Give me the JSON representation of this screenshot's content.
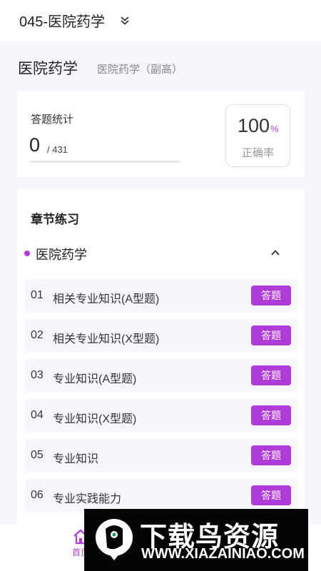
{
  "header": {
    "title": "045-医院药学",
    "dropdown_icon": "double-chevron-down-icon"
  },
  "subject": {
    "name": "医院药学",
    "level": "医院药学（副高）"
  },
  "stats": {
    "label": "答题统计",
    "answered": "0",
    "total": "/ 431",
    "progress": 0,
    "accuracy_value": "100",
    "accuracy_unit": "%",
    "accuracy_label": "正确率"
  },
  "chapters": {
    "title": "章节练习",
    "group": {
      "name": "医院药学",
      "expand_icon": "chevron-up-icon"
    },
    "items": [
      {
        "num": "01",
        "title": "相关专业知识(A型题)",
        "action": "答题"
      },
      {
        "num": "02",
        "title": "相关专业知识(X型题)",
        "action": "答题"
      },
      {
        "num": "03",
        "title": "专业知识(A型题)",
        "action": "答题"
      },
      {
        "num": "04",
        "title": "专业知识(X型题)",
        "action": "答题"
      },
      {
        "num": "05",
        "title": "专业知识",
        "action": "答题"
      },
      {
        "num": "06",
        "title": "专业实践能力",
        "action": "答题"
      }
    ]
  },
  "bottom_nav": {
    "home_label": "首页",
    "home_icon": "home-icon"
  },
  "watermark": {
    "text": "下载鸟资源",
    "url": "WWW.XIAZAINIAO.COM"
  },
  "colors": {
    "accent": "#b03bd8",
    "background": "#f5f6fa"
  }
}
